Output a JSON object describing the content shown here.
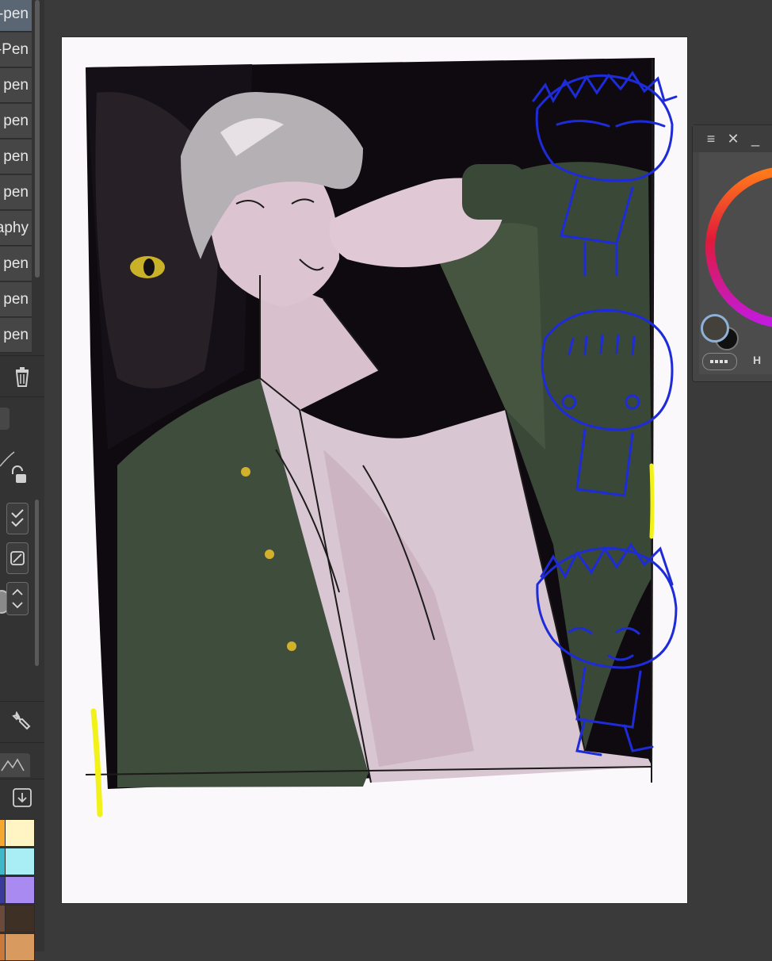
{
  "brush_list": {
    "items": [
      {
        "label": "G-pen",
        "selected": true
      },
      {
        "label": "G-Pen",
        "selected": false
      },
      {
        "label": "Turnip pen",
        "selected": false
      },
      {
        "label": "Mapping pen",
        "selected": false
      },
      {
        "label": "Round pen",
        "selected": false
      },
      {
        "label": "Milli pen",
        "selected": false
      },
      {
        "label": "Calligraphy",
        "selected": false
      },
      {
        "label": "Marker pen",
        "selected": false
      },
      {
        "label": "Ink pen",
        "selected": false
      },
      {
        "label": "Pixel pen",
        "selected": false
      }
    ]
  },
  "tool_panel": {
    "icons": [
      "trash-icon",
      "lock-icon",
      "check-icon",
      "no-entry-icon",
      "spin-arrows-icon",
      "wrench-icon",
      "mountain-icon",
      "download-icon"
    ]
  },
  "palette": {
    "colors": [
      "#f4a830",
      "#fff4c4",
      "#3fb7c7",
      "#a8eef4",
      "#3a3a9a",
      "#a98af0",
      "#6a4a3a",
      "#3f3026",
      "#c97a3a",
      "#d89a5e"
    ]
  },
  "color_window": {
    "icons": [
      "menu-icon",
      "close-icon",
      "minimize-icon"
    ],
    "hsv_label": "H",
    "main_color": "#44403a",
    "sub_color": "#101010",
    "accent": "#8fb1d8"
  },
  "colors": {
    "app_background": "#3a3a3a",
    "panel_background": "#333333",
    "canvas_paper": "#fbf8fb",
    "sketch_blue": "#1e2bd8",
    "highlight_yellow": "#f2f21a"
  }
}
